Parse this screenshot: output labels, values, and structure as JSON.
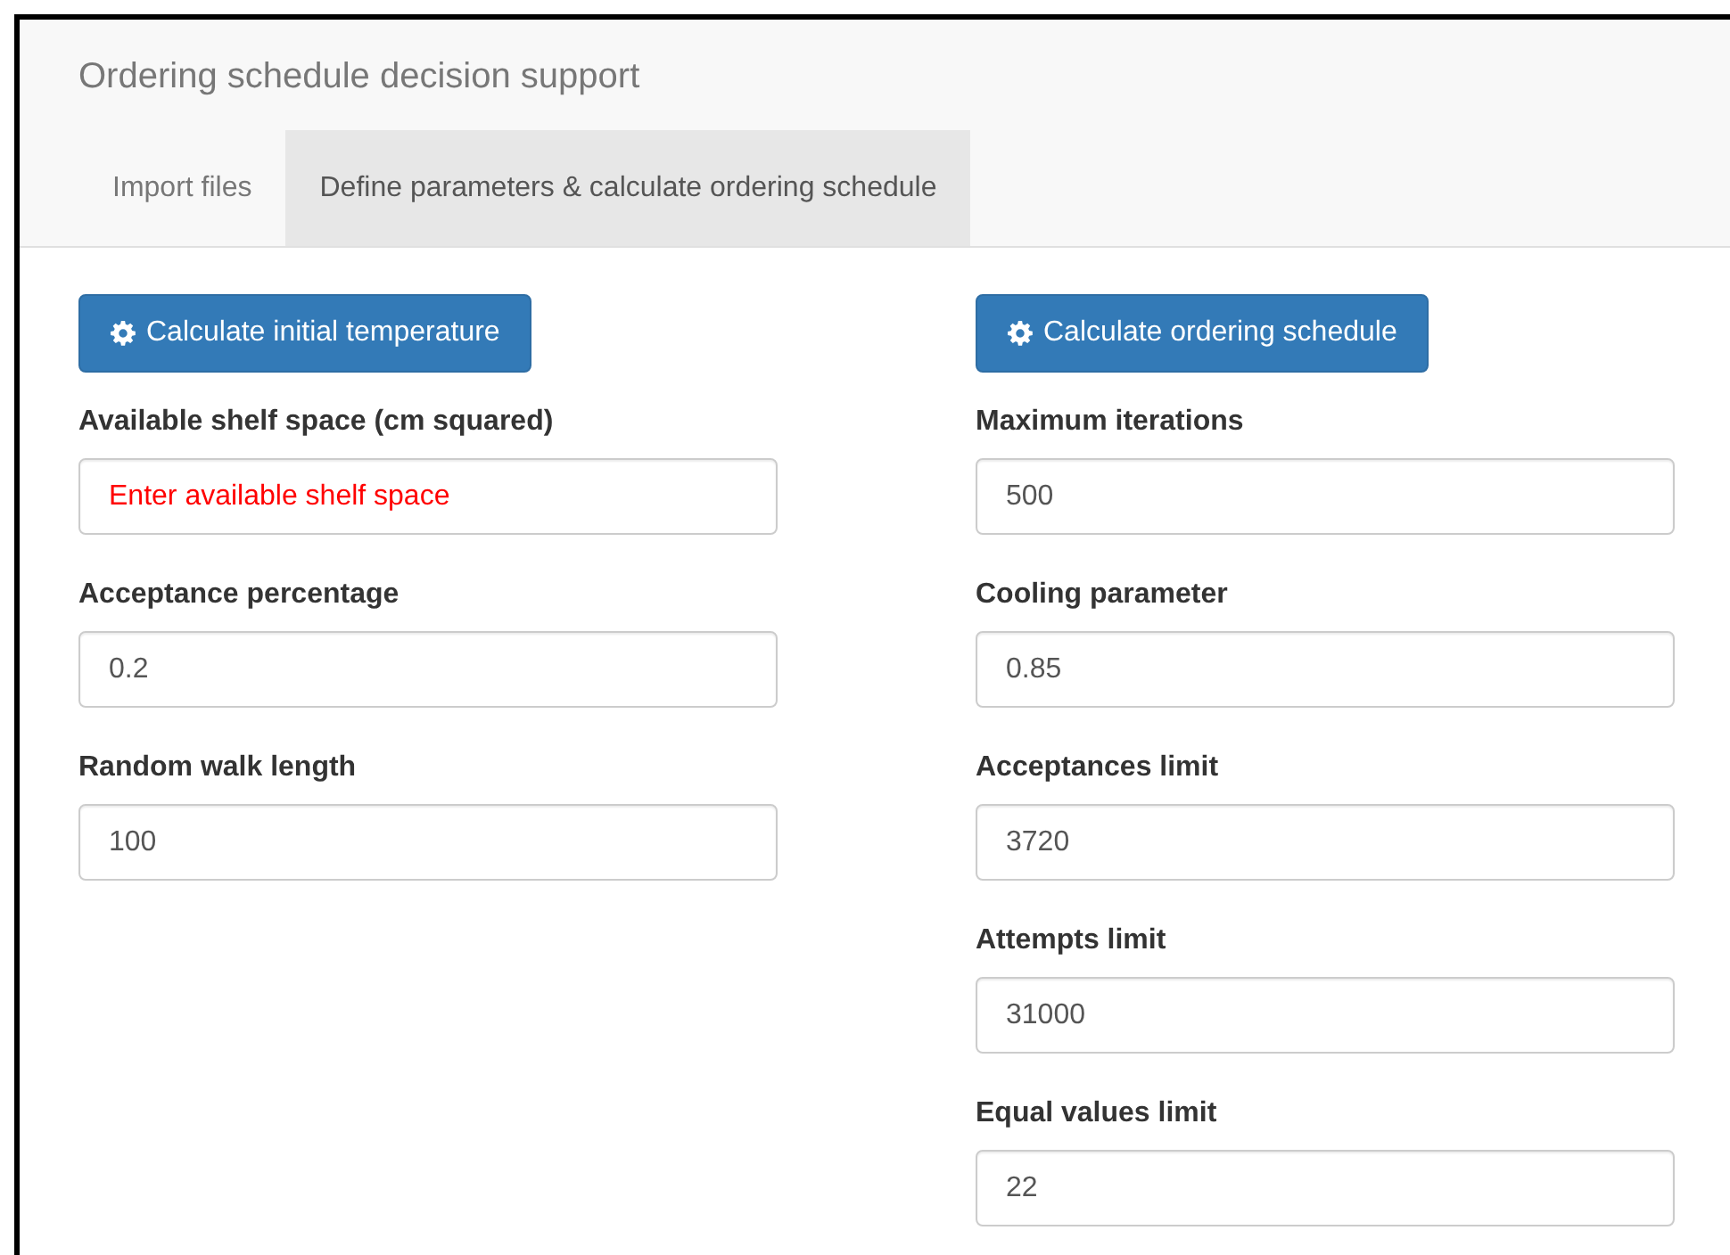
{
  "header": {
    "title": "Ordering schedule decision support"
  },
  "tabs": [
    {
      "label": "Import files",
      "selected": false
    },
    {
      "label": "Define parameters & calculate ordering schedule",
      "selected": true
    }
  ],
  "columns": [
    {
      "button": {
        "label": "Calculate initial temperature"
      },
      "fields": [
        {
          "label": "Available shelf space (cm squared)",
          "placeholder": "Enter available shelf space"
        },
        {
          "label": "Acceptance percentage",
          "value": "0.2"
        },
        {
          "label": "Random walk length",
          "value": "100"
        }
      ]
    },
    {
      "button": {
        "label": "Calculate ordering schedule"
      },
      "fields": [
        {
          "label": "Maximum iterations",
          "value": "500"
        },
        {
          "label": "Cooling parameter",
          "value": "0.85"
        },
        {
          "label": "Acceptances limit",
          "value": "3720"
        },
        {
          "label": "Attempts limit",
          "value": "31000"
        },
        {
          "label": "Equal values limit",
          "value": "22"
        }
      ]
    }
  ]
}
